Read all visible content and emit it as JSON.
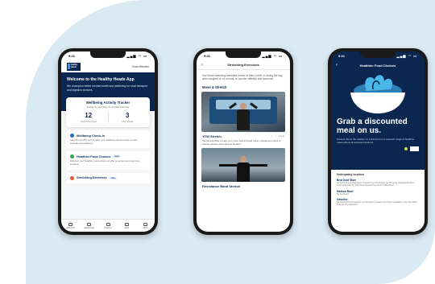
{
  "phone1": {
    "status_time": "9:41",
    "status_icons": "▂▄▆ ◠ ▭",
    "logo_text": "Healthy Heads",
    "header_link": "Grow Member",
    "hero_title": "Welcome to the Healthy Heads App",
    "hero_body": "We champion better mental health and wellbeing for road transport and logistics workers.",
    "tracker": {
      "title": "Wellbeing Activity Tracker",
      "subtitle": "Activity for your Ring for counted each day",
      "stats": [
        {
          "value": "12",
          "label": "Total Completed"
        },
        {
          "value": "3",
          "label": "Day Streak"
        }
      ]
    },
    "cards": [
      {
        "title": "Wellbeing Check-in",
        "badge": "",
        "body": "Take the monthly quiz to track your wellbeing and find ways to build strength and resilience.",
        "color": "#1d6fd1"
      },
      {
        "title": "Healthier Food Choices",
        "badge": "New",
        "body": "Discover your healthier meal options on offer at service and truck stop locations.",
        "color": "#2fa84f"
      },
      {
        "title": "Stretching Exercises",
        "badge": "New",
        "body": "",
        "color": "#e4572e"
      }
    ],
    "tabs": [
      {
        "label": "Welcome"
      },
      {
        "label": "Resources"
      },
      {
        "label": "Support"
      },
      {
        "label": "Chat"
      },
      {
        "label": "More"
      }
    ]
  },
  "phone2": {
    "status_time": "9:41",
    "status_icons": "▂▄▆ ◠ ▭",
    "back_icon": "‹",
    "title": "Stretching Exercises",
    "intro": "Use these stretching exercises before or after a shift, or during the day when stopped or on a break, to counter stiffness and soreness.",
    "section": "Move & Stretch",
    "exercise1": {
      "title": "YTW Stretch",
      "time": "2 min",
      "body": "Simple exercise to help you move real and feel better. Movement helps to reduce tension and improve posture."
    },
    "exercise2": {
      "title": "Resistance Band Stretch"
    }
  },
  "phone3": {
    "status_time": "9:41",
    "status_icons": "▂▄▆ ◠ ▭",
    "back_icon": "‹",
    "title": "Healthier Food Choices",
    "promo_title": "Grab a discounted meal on us.",
    "promo_body": "Present this to the cashier for a discount on a selected range of healthier meal options at selected locations.",
    "list_header": "Participating locations",
    "locations": [
      {
        "name": "Best Gold Store",
        "desc": "4g Something bg Sandwich Toasted Cup Sunflowers 4g Pizza bar Seeds/Grain/Rye, Cup Sunflowers bg Sandwich Toasted Cup Panini Salad Bowl"
      },
      {
        "name": "Medium Bowl",
        "desc": "Bg Sandwich"
      },
      {
        "name": "Gasoline",
        "desc": "Bg Sandwich bg Sandwich bg Sandwich Toasted Cup Panini Salad/Rye Cup Sandwich Toasted Cup Sandwich"
      }
    ],
    "colors": {
      "navy": "#0b2750",
      "leaf": "#4bb7e8",
      "bowl": "#ffffff",
      "accent": "#c6e03a"
    }
  },
  "icons": [
    "signal-icon",
    "wifi-icon",
    "battery-icon",
    "back-chevron-icon",
    "home-icon",
    "resources-icon",
    "support-icon",
    "chat-icon",
    "more-icon",
    "salad-bowl-icon"
  ]
}
